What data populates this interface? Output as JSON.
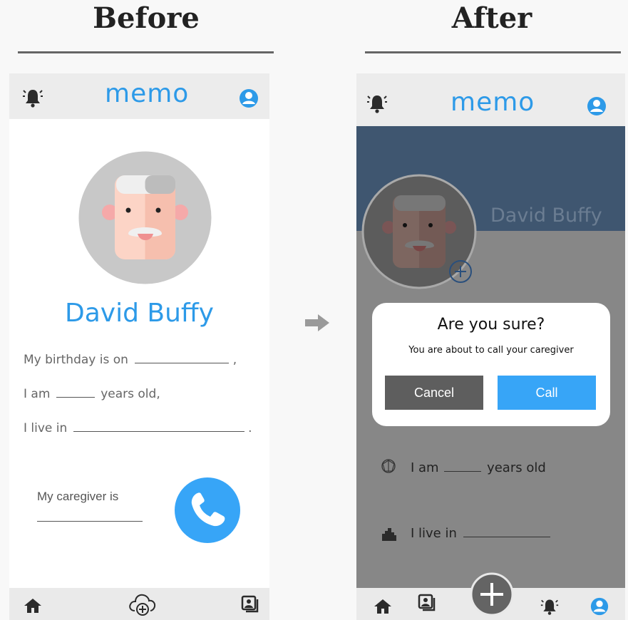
{
  "headings": {
    "before": "Before",
    "after": "After"
  },
  "before": {
    "logo": "memo",
    "name": "David Buffy",
    "birthday": {
      "text": "My birthday is on",
      "suffix": ","
    },
    "age": {
      "prefix": "I am",
      "suffix": "years old,"
    },
    "live": {
      "text": "I live in",
      "suffix": "."
    },
    "caregiver": "My caregiver is"
  },
  "after": {
    "logo": "memo",
    "name": "David Buffy",
    "age": {
      "prefix": "I am",
      "suffix": "years old"
    },
    "live": "I live in",
    "dialog": {
      "title": "Are you sure?",
      "message": "You are about to call your caregiver",
      "cancel": "Cancel",
      "call": "Call"
    }
  },
  "colors": {
    "accent": "#2d9ae8",
    "call_button": "#37a5f7",
    "cancel_button": "#5e5e5e",
    "banner": "#3f5670",
    "overlay": "#878787"
  },
  "icons": [
    "bell-icon",
    "user-icon",
    "home-icon",
    "cloud-add-icon",
    "photo-album-icon",
    "phone-icon",
    "arrow-right-icon",
    "plus-icon",
    "globe-icon",
    "city-icon",
    "avatar-face"
  ]
}
